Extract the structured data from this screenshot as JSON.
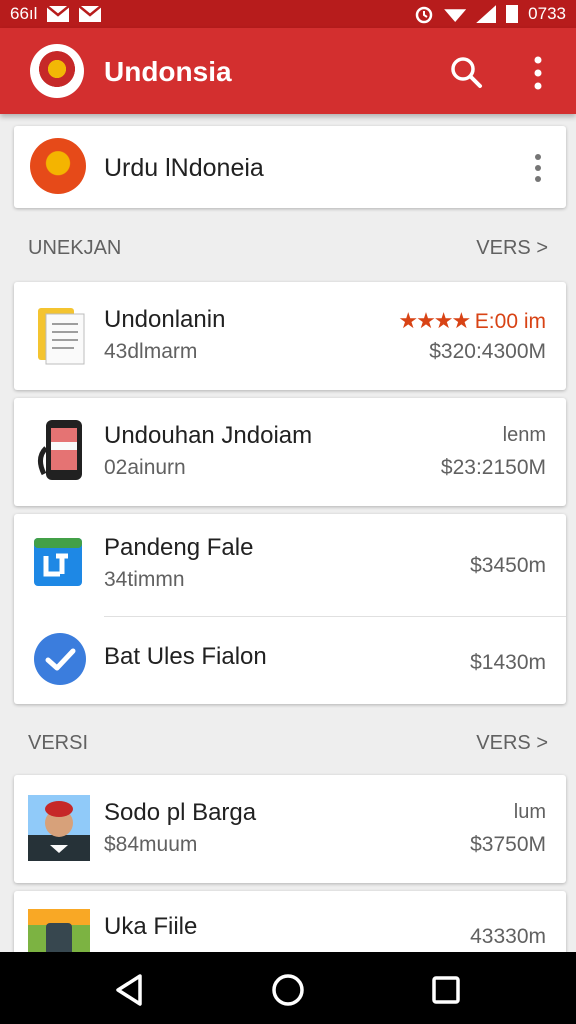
{
  "status_bar": {
    "carrier": "66ıl",
    "time": "0733"
  },
  "toolbar": {
    "title": "Undonsia"
  },
  "featured": {
    "name": "Urdu lNdoneia"
  },
  "sections": [
    {
      "label": "UNEKJAN",
      "more_label": "VERS >"
    },
    {
      "label": "VERSI",
      "more_label": "VERS >"
    }
  ],
  "items": [
    {
      "title": "Undonlanin",
      "subtitle": "43dlmarm",
      "rating_text": "E:00 im",
      "price": "$320:4300M",
      "stars": "★★★★"
    },
    {
      "title": "Undouhan Jndoiam",
      "subtitle": "02ainurn",
      "right_top": "lenm",
      "price": "$23:2150M"
    },
    {
      "title": "Pandeng Fale",
      "subtitle": "34timmn",
      "price": "$3450m"
    },
    {
      "title": "Bat Ules Fialon",
      "price": "$1430m"
    },
    {
      "title": "Sodo pl Barga",
      "subtitle": "$84muum",
      "right_top": "lum",
      "price": "$3750M"
    },
    {
      "title": "Uka Fiile",
      "price": "43330m"
    }
  ],
  "colors": {
    "primary": "#d32f2f",
    "primary_dark": "#b71c1c",
    "accent": "#d84315"
  },
  "icons": [
    "search-icon",
    "more-vert-icon",
    "back-icon",
    "home-icon",
    "recents-icon"
  ]
}
